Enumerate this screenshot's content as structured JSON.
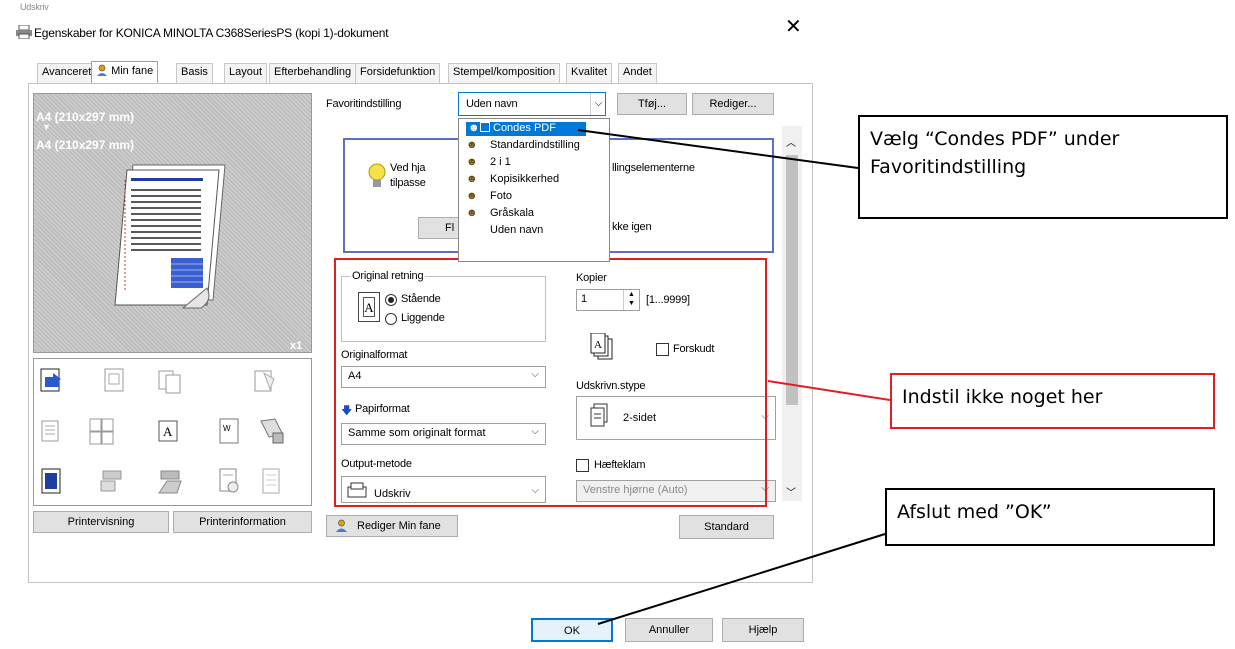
{
  "window": {
    "corner_text": "Udskriv",
    "title": "Egenskaber for KONICA MINOLTA C368SeriesPS (kopi 1)-dokument",
    "close": "✕"
  },
  "tabs": [
    "Avanceret",
    "Min fane",
    "Basis",
    "Layout",
    "Efterbehandling",
    "Forsidefunktion",
    "Stempel/komposition",
    "Kvalitet",
    "Andet"
  ],
  "preview": {
    "paper_1": "A4 (210x297 mm)",
    "arrow": "▼",
    "paper_2": "A4 (210x297 mm)",
    "copies": "x1"
  },
  "buttons": {
    "preview": "Printervisning",
    "info": "Printerinformation",
    "edit_tab": "Rediger Min fane",
    "standard": "Standard",
    "add": "Tføj...",
    "edit": "Rediger...",
    "ok": "OK",
    "cancel": "Annuller",
    "help": "Hjælp"
  },
  "favorite": {
    "label": "Favoritindstilling",
    "value": "Uden navn",
    "options": [
      "Condes PDF",
      "Standardindstilling",
      "2 i 1",
      "Kopisikkerhed",
      "Foto",
      "Gråskala",
      "Uden navn"
    ],
    "selected_index": 0
  },
  "info_box": {
    "line1_prefix": "Ved hja",
    "line1_suffix": "llingselementerne",
    "line2_prefix": "tilpasse",
    "button_prefix": "Fl",
    "button_suffix": "kke igen"
  },
  "orientation": {
    "legend": "Original retning",
    "portrait": "Stående",
    "landscape": "Liggende",
    "selected": "portrait"
  },
  "original_format": {
    "label": "Originalformat",
    "value": "A4"
  },
  "paper_format": {
    "label": "Papirformat",
    "value": "Samme som originalt format"
  },
  "output": {
    "label": "Output-metode",
    "value": "Udskriv"
  },
  "copies": {
    "label": "Kopier",
    "value": "1",
    "range": "[1...9999]"
  },
  "offset": {
    "label": "Forskudt",
    "checked": false
  },
  "print_type": {
    "label": "Udskrivn.stype",
    "value": "2-sidet"
  },
  "staple": {
    "label": "Hæfteklam",
    "checked": false,
    "position": "Venstre hjørne (Auto)"
  },
  "callouts": {
    "c1": "Vælg “Condes PDF” under Favoritindstilling",
    "c2": "Indstil ikke noget her",
    "c3": "Afslut med ”OK”"
  },
  "colors": {
    "accent": "#0078d7",
    "red_frame": "#e02020",
    "info_border": "#5b6fc8"
  }
}
